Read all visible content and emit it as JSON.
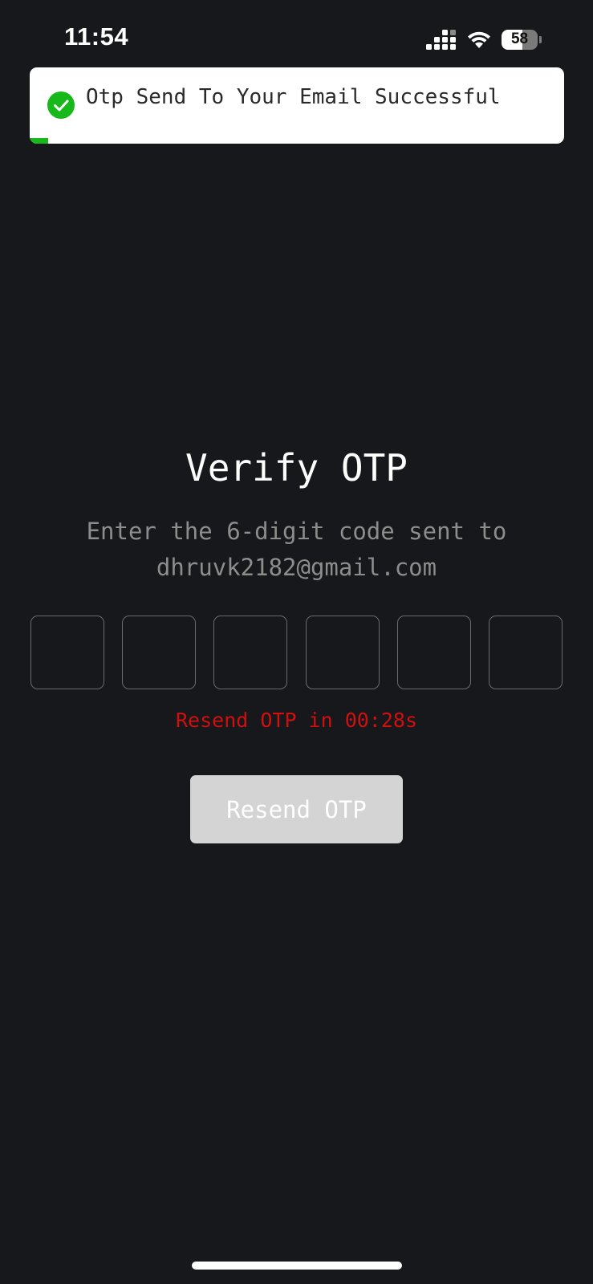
{
  "status_bar": {
    "time": "11:54",
    "battery_level": "58",
    "icons": [
      "cellular-signal-icon",
      "wifi-icon",
      "battery-icon"
    ]
  },
  "toast": {
    "message": "Otp Send To Your Email Successful",
    "icon": "check-circle-icon",
    "progress_fraction": 0.035,
    "colors": {
      "background": "#ffffff",
      "success": "#16b81a"
    }
  },
  "verify": {
    "title": "Verify OTP",
    "subtitle_line1": "Enter the 6-digit code sent to",
    "email": "dhruvk2182@gmail.com",
    "otp_digits": [
      "",
      "",
      "",
      "",
      "",
      ""
    ],
    "countdown": "Resend OTP in 00:28s",
    "resend_label": "Resend OTP"
  },
  "colors": {
    "background": "#17181b",
    "countdown": "#d10f0f",
    "button_disabled": "#d4d4d4"
  }
}
